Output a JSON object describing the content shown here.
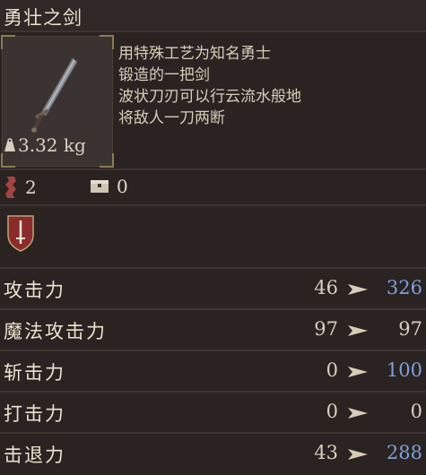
{
  "item": {
    "title": "勇壮之剑",
    "weight": "3.32 kg",
    "description": [
      "用特殊工艺为知名勇士",
      "锻造的一把剑",
      "波状刀刃可以行云流水般地",
      "将敌人一刀两断"
    ]
  },
  "slots": {
    "upgrade_count": "2",
    "socket_count": "0"
  },
  "stats": [
    {
      "label": "攻击力",
      "current": "46",
      "new": "326",
      "improved": true
    },
    {
      "label": "魔法攻击力",
      "current": "97",
      "new": "97",
      "improved": false
    },
    {
      "label": "斩击力",
      "current": "0",
      "new": "100",
      "improved": true
    },
    {
      "label": "打击力",
      "current": "0",
      "new": "0",
      "improved": false
    },
    {
      "label": "击退力",
      "current": "43",
      "new": "288",
      "improved": true
    }
  ],
  "colors": {
    "background": "#2a2322",
    "improved_value": "#7f9fd8",
    "badge_red": "#8c2b2b",
    "frame_gold": "#8d7a55"
  },
  "icons": {
    "weight": "weight-icon",
    "upgrade": "whetstone-icon",
    "socket": "chest-icon",
    "attack_type": "sword-shield-icon",
    "arrow": "arrow-right-icon"
  }
}
